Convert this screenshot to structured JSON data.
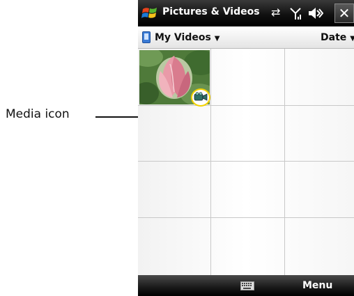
{
  "callout": {
    "label": "Media icon"
  },
  "titlebar": {
    "title": "Pictures & Videos",
    "icons": [
      "windows-logo",
      "connectivity-icon",
      "signal-icon",
      "volume-icon",
      "close-icon"
    ],
    "close_glyph": "✕"
  },
  "menubar": {
    "folder": "My Videos",
    "folder_caret": "▼",
    "sort": "Date",
    "sort_caret": "▼"
  },
  "grid": {
    "columns": 3,
    "rows": 4,
    "items": [
      {
        "type": "video",
        "thumbnail": "pink-lotus-flower",
        "badge": "media-icon"
      }
    ]
  },
  "softbar": {
    "center_icon": "keyboard-icon",
    "right_label": "Menu"
  },
  "colors": {
    "titlebar": "#111111",
    "highlight_ring": "#f3d200",
    "softbar": "#181818"
  }
}
